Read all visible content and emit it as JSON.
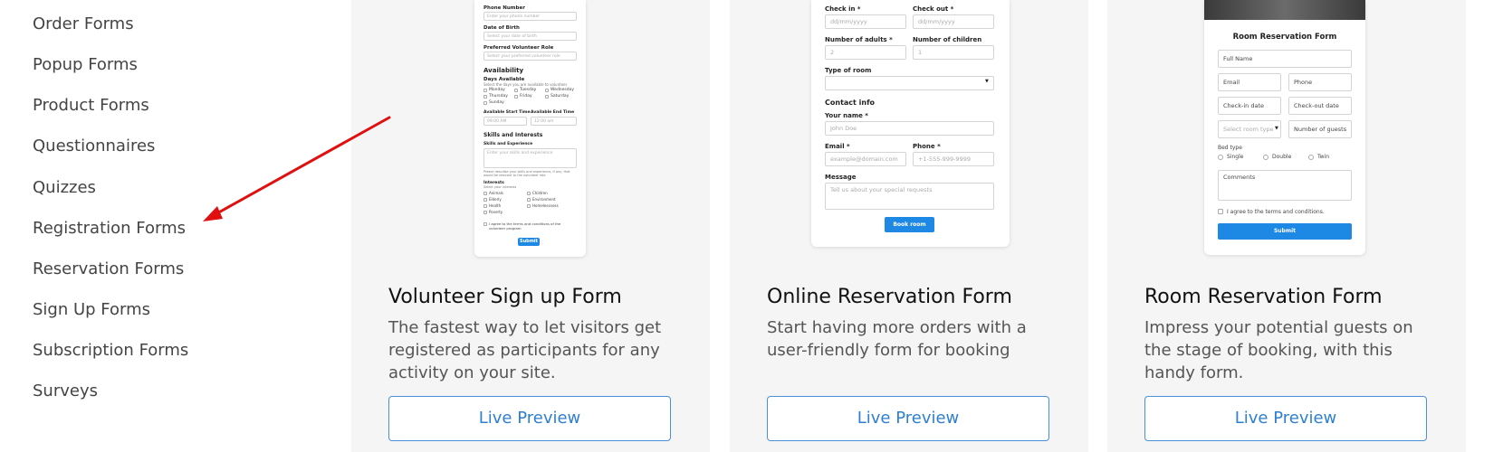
{
  "sidebar": {
    "items": [
      {
        "label": "Order Forms"
      },
      {
        "label": "Popup Forms"
      },
      {
        "label": "Product Forms"
      },
      {
        "label": "Questionnaires"
      },
      {
        "label": "Quizzes"
      },
      {
        "label": "Registration Forms"
      },
      {
        "label": "Reservation Forms"
      },
      {
        "label": "Sign Up Forms"
      },
      {
        "label": "Subscription Forms"
      },
      {
        "label": "Surveys"
      }
    ]
  },
  "colors": {
    "arrow": "#e01010",
    "accent": "#2e7fd1",
    "card_bg": "#f5f5f6",
    "submit_blue": "#1e88e5"
  },
  "cards": [
    {
      "title": "Volunteer Sign up Form",
      "description": "The fastest way to let visitors get registered as participants for any activity on your site.",
      "preview_label": "Live Preview",
      "thumb": {
        "phone_label": "Phone Number",
        "phone_placeholder": "Enter your phone number",
        "dob_label": "Date of Birth",
        "dob_placeholder": "Select your date of birth",
        "role_label": "Preferred Volunteer Role",
        "role_placeholder": "Select your preferred volunteer role",
        "availability_heading": "Availability",
        "days_label": "Days Available",
        "days_hint": "Select the days you are available to volunteer",
        "days": [
          "Monday",
          "Tuesday",
          "Wednesday",
          "Thursday",
          "Friday",
          "Saturday",
          "Sunday"
        ],
        "start_label": "Available Start Time",
        "start_placeholder": "09:00 AM",
        "end_label": "Available End Time",
        "end_placeholder": "12:00 am",
        "skills_heading": "Skills and Interests",
        "skills_label": "Skills and Experience",
        "skills_placeholder": "Enter your skills and experience",
        "skills_hint": "Please describe your skills and experience, if any, that would be relevant to the volunteer role",
        "interests_label": "Interests",
        "interests_hint": "Select your interests",
        "interests": [
          "Animals",
          "Children",
          "Elderly",
          "Environment",
          "Health",
          "Homelessness",
          "Poverty"
        ],
        "agree": "I agree to the terms and conditions of the volunteer program",
        "submit": "Submit"
      }
    },
    {
      "title": "Online Reservation Form",
      "description": "Start having more orders with a user-friendly form for booking",
      "preview_label": "Live Preview",
      "thumb": {
        "checkin_label": "Check in *",
        "checkout_label": "Check out *",
        "date_placeholder": "dd/mm/yyyy",
        "adults_label": "Number of adults *",
        "adults_value": "2",
        "children_label": "Number of children",
        "children_value": "1",
        "room_type_label": "Type of room",
        "contact_heading": "Contact info",
        "name_label": "Your name *",
        "name_placeholder": "John Doe",
        "email_label": "Email *",
        "email_placeholder": "example@domain.com",
        "phone_label": "Phone *",
        "phone_placeholder": "+1-555-999-9999",
        "message_label": "Message",
        "message_placeholder": "Tell us about your special requests",
        "submit": "Book room"
      }
    },
    {
      "title": "Room Reservation Form",
      "description": "Impress your potential guests on the stage of booking, with this handy form.",
      "preview_label": "Live Preview",
      "thumb": {
        "heading": "Room Reservation Form",
        "full_name": "Full Name",
        "email": "Email",
        "phone": "Phone",
        "checkin": "Check-in date",
        "checkout": "Check-out date",
        "room_type": "Select room type",
        "guests": "Number of guests",
        "bed_type_label": "Bed type",
        "bed_options": [
          "Single",
          "Double",
          "Twin"
        ],
        "comments": "Comments",
        "agree": "I agree to the terms and conditions.",
        "submit": "Submit"
      }
    }
  ]
}
